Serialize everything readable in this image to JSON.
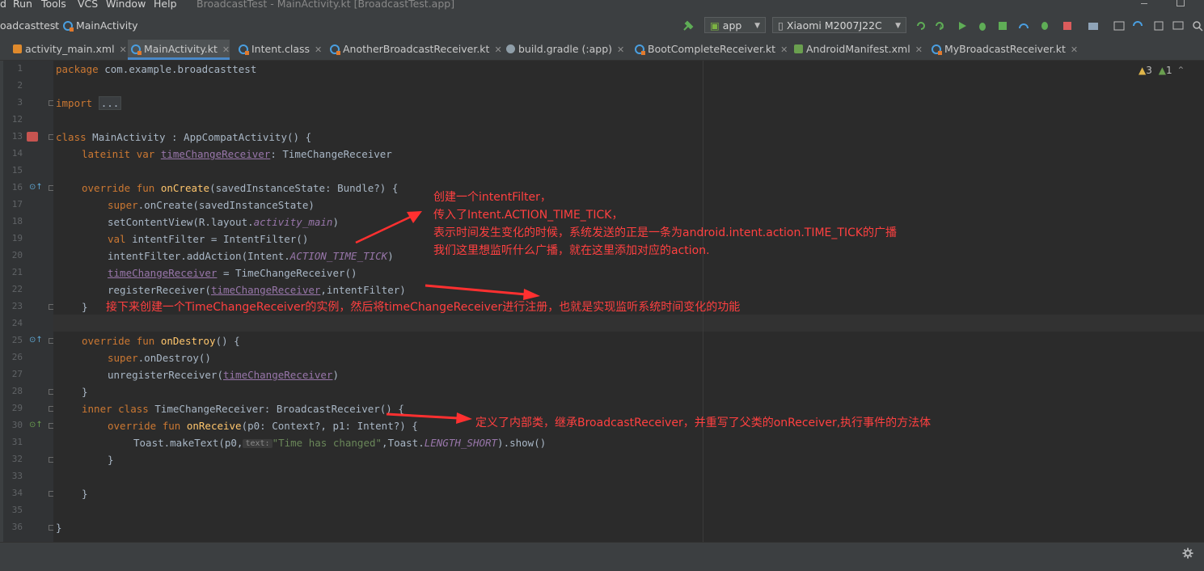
{
  "menu": {
    "items": [
      "d",
      "Run",
      "Tools",
      "VCS",
      "Window",
      "Help"
    ],
    "window_title": "BroadcastTest - MainActivity.kt [BroadcastTest.app]"
  },
  "breadcrumb": {
    "project": "oadcasttest",
    "file": "MainActivity"
  },
  "toolbar": {
    "run_config": "app",
    "device": "Xiaomi M2007J22C"
  },
  "tabs": [
    {
      "label": "activity_main.xml",
      "icon": "xml-icon"
    },
    {
      "label": "MainActivity.kt",
      "icon": "kotlin-class-icon",
      "active": true
    },
    {
      "label": "Intent.class",
      "icon": "java-class-icon"
    },
    {
      "label": "AnotherBroadcastReceiver.kt",
      "icon": "kotlin-class-icon"
    },
    {
      "label": "build.gradle (:app)",
      "icon": "gradle-icon"
    },
    {
      "label": "BootCompleteReceiver.kt",
      "icon": "kotlin-class-icon"
    },
    {
      "label": "AndroidManifest.xml",
      "icon": "manifest-icon"
    },
    {
      "label": "MyBroadcastReceiver.kt",
      "icon": "kotlin-class-icon"
    }
  ],
  "inspections": {
    "warnings": "3",
    "weak_warnings": "1"
  },
  "line_numbers": [
    "1",
    "2",
    "3",
    "12",
    "13",
    "14",
    "15",
    "16",
    "17",
    "18",
    "19",
    "20",
    "21",
    "22",
    "23",
    "24",
    "25",
    "26",
    "27",
    "28",
    "29",
    "30",
    "31",
    "32",
    "33",
    "34",
    "35",
    "36"
  ],
  "code": {
    "l1a": "package",
    "l1b": " com.example.broadcasttest",
    "l3a": "import",
    "l3b": "...",
    "l13a": "class",
    "l13b": " MainActivity : AppCompatActivity() {",
    "l14a": "lateinit var",
    "l14b": "timeChangeReceiver",
    "l14c": ": TimeChangeReceiver",
    "l16a": "override fun",
    "l16b": "onCreate",
    "l16c": "(savedInstanceState: Bundle?) {",
    "l17a": "super",
    "l17b": ".onCreate(savedInstanceState)",
    "l18a": "setContentView(R.layout.",
    "l18b": "activity_main",
    "l18c": ")",
    "l19a": "val",
    "l19b": " intentFilter = IntentFilter()",
    "l20a": "intentFilter.addAction(Intent.",
    "l20b": "ACTION_TIME_TICK",
    "l20c": ")",
    "l21a": "timeChangeReceiver",
    "l21b": " = TimeChangeReceiver()",
    "l22a": "registerReceiver(",
    "l22b": "timeChangeReceiver",
    "l22c": ",intentFilter)",
    "l23": "}",
    "l25a": "override fun",
    "l25b": "onDestroy",
    "l25c": "() {",
    "l26a": "super",
    "l26b": ".onDestroy()",
    "l27a": "unregisterReceiver(",
    "l27b": "timeChangeReceiver",
    "l27c": ")",
    "l28": "}",
    "l29a": "inner class",
    "l29b": " TimeChangeReceiver: BroadcastReceiver() {",
    "l30a": "override fun",
    "l30b": "onReceive",
    "l30c": "(p0: Context?, p1: Intent?) {",
    "l31a": "Toast.makeText(p0,",
    "l31hint": "text:",
    "l31b": "\"Time has changed\"",
    "l31c": ",Toast.",
    "l31d": "LENGTH_SHORT",
    "l31e": ").show()",
    "l32": "}",
    "l34": "}",
    "l36": "}"
  },
  "annotations": {
    "a1": "创建一个intentFilter，",
    "a2": "传入了Intent.ACTION_TIME_TICK，",
    "a3": "表示时间发生变化的时候，系统发送的正是一条为android.intent.action.TIME_TICK的广播",
    "a4": "我们这里想监听什么广播，就在这里添加对应的action.",
    "a5": "接下来创建一个TimeChangeReceiver的实例，然后将timeChangeReceiver进行注册，也就是实现监听系统时间变化的功能",
    "a6": "定义了内部类，继承BroadcastReceiver，并重写了父类的onReceiver,执行事件的方法体"
  },
  "colors": {
    "annotation": "#ff4040",
    "keyword": "#cc7832",
    "function": "#ffc66d",
    "property": "#9876aa",
    "string": "#6a8759"
  }
}
